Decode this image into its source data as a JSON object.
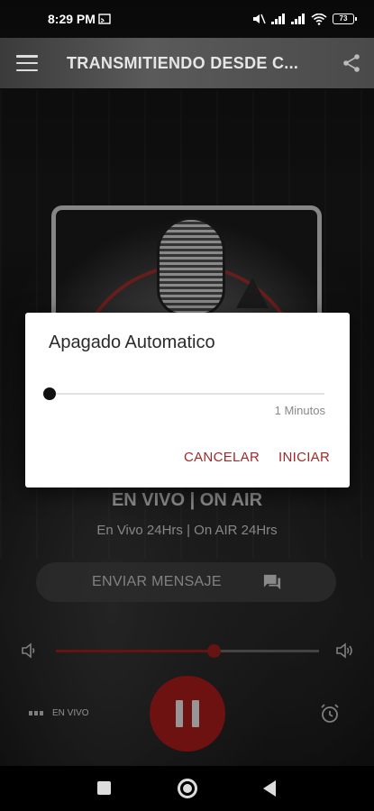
{
  "status_bar": {
    "time": "8:29 PM",
    "battery": "73"
  },
  "app_bar": {
    "menu_icon": "hamburger-menu-icon",
    "title": "TRANSMITIENDO DESDE C...",
    "share_icon": "share-icon"
  },
  "station": {
    "title": "EN VIVO | ON AIR",
    "subtitle": "En Vivo 24Hrs | On AIR 24Hrs"
  },
  "send_message": {
    "label": "ENVIAR MENSAJE",
    "icon": "chat-icon"
  },
  "volume": {
    "level": 0.6,
    "color": "#a31f1f"
  },
  "playback": {
    "live_label": "EN VIVO",
    "state": "playing",
    "button_color": "#b11c1c"
  },
  "dialog": {
    "title": "Apagado Automatico",
    "slider_value": 0,
    "value_label": "1 Minutos",
    "cancel_label": "CANCELAR",
    "start_label": "INICIAR",
    "accent": "#9c2a2a"
  }
}
